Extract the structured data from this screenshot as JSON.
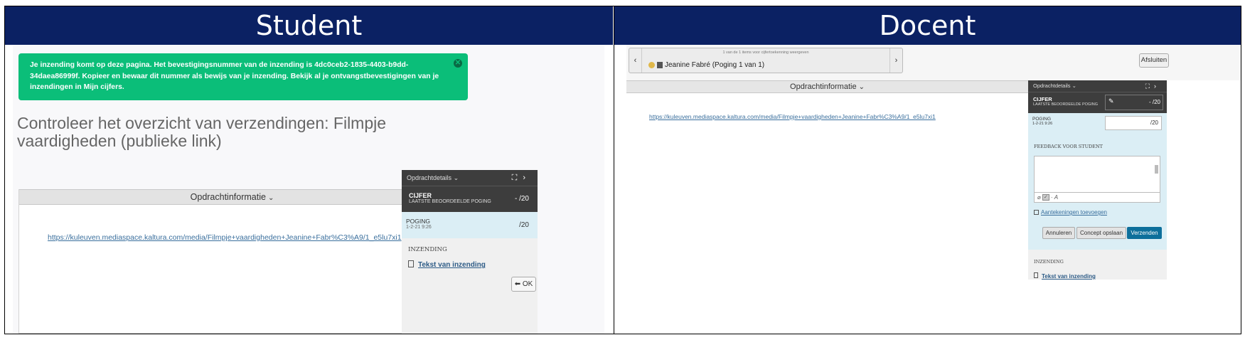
{
  "student": {
    "heading": "Student",
    "success_message": "Je inzending komt op deze pagina. Het bevestigingsnummer van de inzending is 4dc0ceb2-1835-4403-b9dd-34daea86999f. Kopieer en bewaar dit nummer als bewijs van je inzending. Bekijk al je ontvangstbevestigingen van je inzendingen in Mijn cijfers.",
    "page_title": "Controleer het overzicht van verzendingen: Filmpje vaardigheden (publieke link)",
    "info_header": "Opdrachtinformatie",
    "link": "https://kuleuven.mediaspace.kaltura.com/media/Filmpje+vaardigheden+Jeanine+Fabr%C3%A9/1_e5lu7xi1",
    "side": {
      "title": "Opdrachtdetails",
      "cijfer_label": "CIJFER",
      "cijfer_sub": "LAATSTE BEOORDEELDE POGING",
      "cijfer_score": "- /20",
      "poging_label": "POGING",
      "poging_date": "1-2-21 9:26",
      "poging_score": "/20",
      "inzending_label": "INZENDING",
      "tekst_link": "Tekst van inzending",
      "ok_label": "OK"
    }
  },
  "docent": {
    "heading": "Docent",
    "nav_count": "1 van de 1 items voor cijfertoekenning weergeven",
    "nav_name": "Jeanine Fabré (Poging 1 van 1)",
    "afsluiten": "Afsluiten",
    "info_header": "Opdrachtinformatie",
    "link": "https://kuleuven.mediaspace.kaltura.com/media/Filmpje+vaardigheden+Jeanine+Fabr%C3%A9/1_e5lu7xi1",
    "side": {
      "title": "Opdrachtdetails",
      "cijfer_label": "CIJFER",
      "cijfer_sub": "LAATSTE BEOORDEELDE POGING",
      "cijfer_score": "- /20",
      "poging_label": "POGING",
      "poging_date": "1-2-21 9:26",
      "poging_score": "/20",
      "feedback_label": "FEEDBACK VOOR STUDENT",
      "aantekeningen": "Aantekeningen toevoegen",
      "btn_annuleren": "Annuleren",
      "btn_concept": "Concept opslaan",
      "btn_verzenden": "Verzenden",
      "inzending_label": "INZENDING",
      "tekst_link": "Tekst van inzending"
    }
  },
  "colors": {
    "header_bg": "#0b2163",
    "success_bg": "#0bbe79",
    "side_dark": "#3d3d3d",
    "poging_bg": "#dbeef5",
    "verzenden_bg": "#0d6f9b"
  },
  "icons": [
    "close-icon",
    "chevron-down-icon",
    "expand-icon",
    "chevron-right-icon",
    "document-icon",
    "arrow-left-icon",
    "smile-icon",
    "user-icon",
    "pencil-icon",
    "paperclip-icon",
    "calendar-icon"
  ]
}
